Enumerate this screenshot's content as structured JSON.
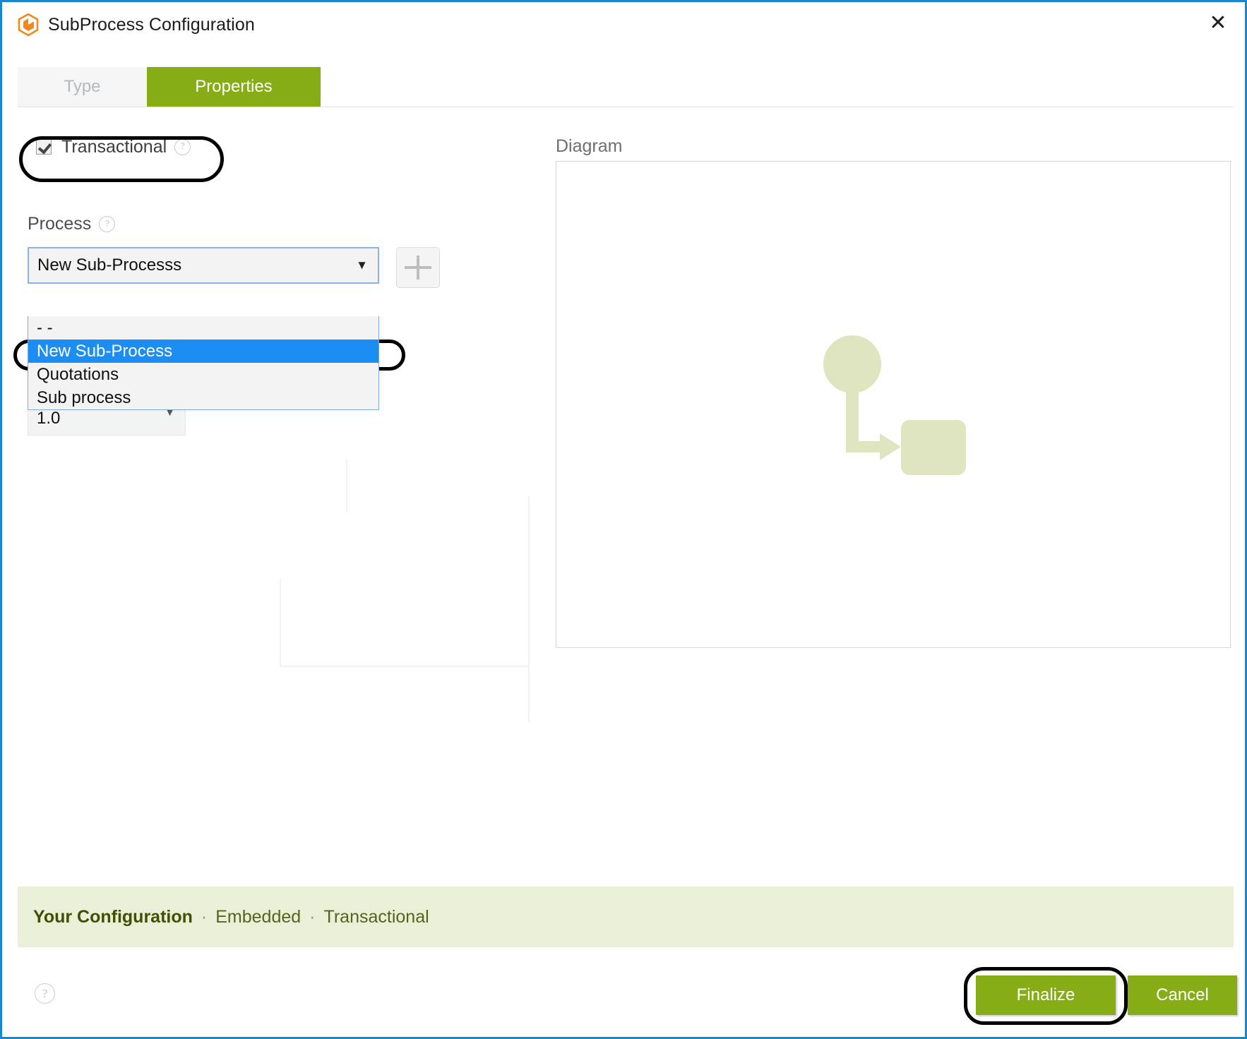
{
  "window": {
    "title": "SubProcess Configuration",
    "icon": "bonita-hexagon-icon",
    "close_label": "✕",
    "border_color": "#1a87cd"
  },
  "tabs": [
    {
      "label": "Type",
      "active": false
    },
    {
      "label": "Properties",
      "active": true
    }
  ],
  "properties": {
    "transactional": {
      "label": "Transactional",
      "checked": true,
      "help": "?"
    },
    "process": {
      "label": "Process",
      "help": "?",
      "selected_value": "New Sub-Processs",
      "caret": "▼",
      "add_button": "+",
      "options": [
        {
          "label": "- -",
          "selected": false
        },
        {
          "label": "New Sub-Process",
          "selected": true
        },
        {
          "label": "Quotations",
          "selected": false
        },
        {
          "label": "Sub process",
          "selected": false
        }
      ]
    },
    "version": {
      "value": "1.0",
      "caret": "▼"
    }
  },
  "diagram": {
    "label": "Diagram",
    "art_color": "#dfe6bf",
    "shapes": [
      "start-event-circle",
      "sequence-flow-arrow",
      "task-rounded-rectangle"
    ]
  },
  "summary": {
    "title": "Your Configuration",
    "separator": "·",
    "items": [
      "Embedded",
      "Transactional"
    ]
  },
  "footer": {
    "help": "?",
    "finalize_label": "Finalize",
    "cancel_label": "Cancel"
  },
  "colors": {
    "accent_green": "#86ac16",
    "summary_band": "#eaefd7",
    "highlight_blue": "#1c8ef3",
    "window_border": "#1a87cd",
    "brand_orange": "#f0881a"
  }
}
